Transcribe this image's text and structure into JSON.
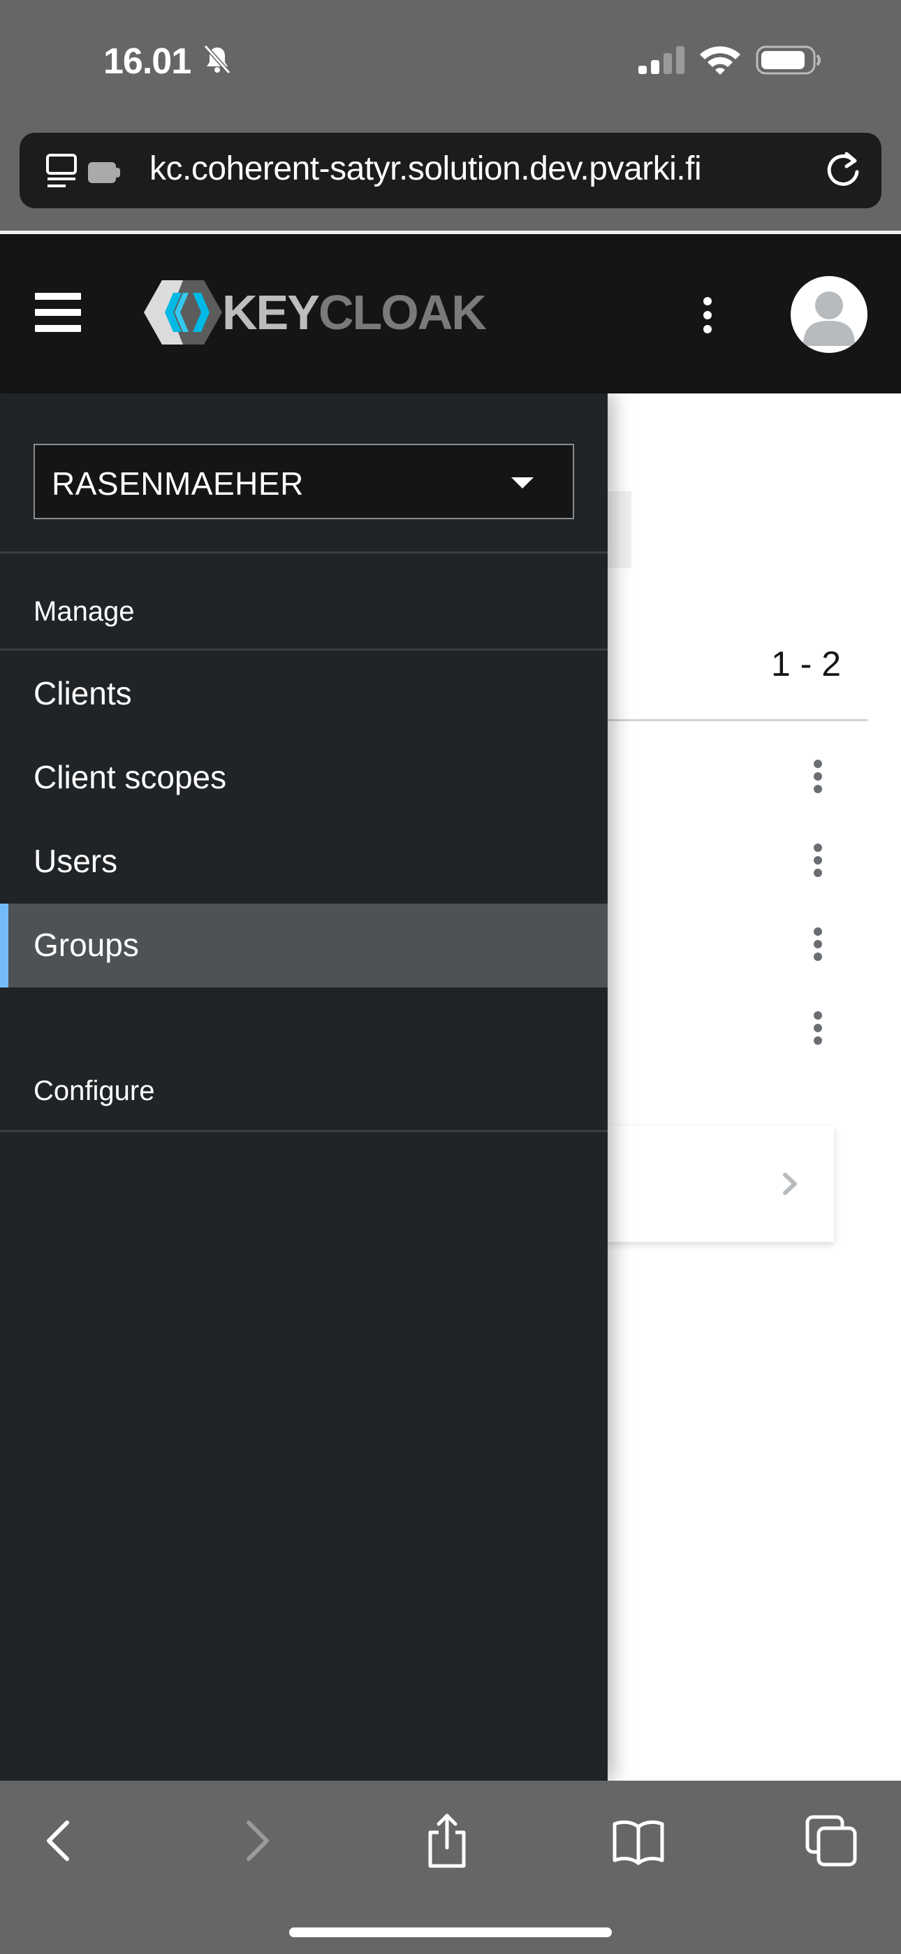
{
  "status_bar": {
    "time": "16.01",
    "icons": [
      "bell-slash-icon",
      "cellular-signal-icon",
      "wifi-icon",
      "battery-icon"
    ]
  },
  "browser": {
    "url": "kc.coherent-satyr.solution.dev.pvarki.fi",
    "icons": [
      "reader-mode-icon",
      "reload-icon"
    ],
    "toolbar_icons": [
      "back-icon",
      "forward-icon",
      "share-icon",
      "bookmarks-icon",
      "tabs-icon"
    ]
  },
  "masthead": {
    "logo_text_part1": "KEY",
    "logo_text_part2": "CLOAK",
    "icons": [
      "hamburger-menu-icon",
      "kebab-menu-icon",
      "user-avatar-icon"
    ]
  },
  "sidebar": {
    "realm": "RASENMAEHER",
    "sections": [
      {
        "title": "Manage",
        "items": [
          {
            "label": "Clients",
            "active": false
          },
          {
            "label": "Client scopes",
            "active": false
          },
          {
            "label": "Users",
            "active": false
          },
          {
            "label": "Groups",
            "active": true
          }
        ]
      },
      {
        "title": "Configure",
        "items": []
      }
    ]
  },
  "content": {
    "pagination": "1 - 2"
  },
  "colors": {
    "accent": "#73bcf7",
    "drawer_bg": "#212427",
    "active_item_bg": "#4f5255",
    "masthead_bg": "#151515"
  }
}
